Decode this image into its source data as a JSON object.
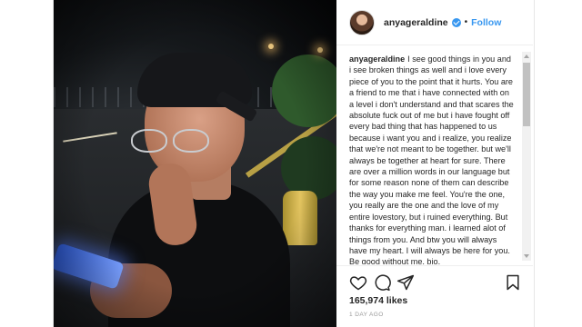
{
  "post": {
    "username": "anyageraldine",
    "separator": "•",
    "follow_label": "Follow",
    "caption_username": "anyageraldine",
    "caption_text": "I see good things in you and i see broken things as well and i love every piece of you to the point that it hurts. You are a friend to me that i have connected with on a level i don't understand and that scares the absolute fuck out of me but i have fought off every bad thing that has happened to us because i want you and i realize, you realize that we're not meant to be together. but we'll always be together at heart for sure. There are over a million words in our language but for some reason none of them can describe the way you make me feel. You're the one, you really are the one and the love of my entire lovestory, but i ruined everything. But thanks for everything man. i learned alot of things from you. And btw you will always have my heart. I will always be here for you. Be good without me, bio.",
    "likes": "165,974 likes",
    "timestamp": "1 DAY AGO"
  },
  "icons": {
    "verified": "verified-badge-icon",
    "like": "heart-icon",
    "comment": "comment-bubble-icon",
    "share": "paper-plane-icon",
    "save": "bookmark-icon"
  },
  "colors": {
    "link_blue": "#3897f0",
    "text": "#262626",
    "muted": "#999999"
  }
}
